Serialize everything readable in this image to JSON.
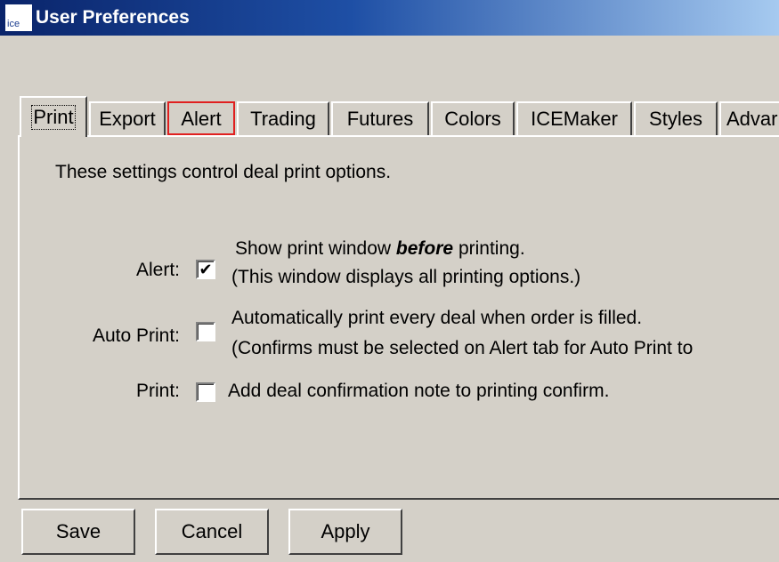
{
  "window": {
    "title": "User Preferences",
    "icon_text": "ice"
  },
  "tabs": [
    {
      "label": "Print",
      "active": true
    },
    {
      "label": "Export",
      "active": false
    },
    {
      "label": "Alert",
      "active": false,
      "highlighted": true
    },
    {
      "label": "Trading",
      "active": false
    },
    {
      "label": "Futures",
      "active": false
    },
    {
      "label": "Colors",
      "active": false
    },
    {
      "label": "ICEMaker",
      "active": false
    },
    {
      "label": "Styles",
      "active": false
    },
    {
      "label": "Advar",
      "active": false
    }
  ],
  "panel": {
    "description": "These settings control deal print options.",
    "options": [
      {
        "label": "Alert:",
        "checked": true,
        "line1_pre": "Show print window ",
        "line1_emph": "before",
        "line1_post": "  printing.",
        "line2": "(This window displays all printing options.)"
      },
      {
        "label": "Auto Print:",
        "checked": false,
        "line1": "Automatically print every deal when order is filled.",
        "line2": "(Confirms must be selected on Alert tab for Auto Print to"
      },
      {
        "label": "Print:",
        "checked": false,
        "line1": "Add deal confirmation note to printing confirm."
      }
    ]
  },
  "buttons": {
    "save": "Save",
    "cancel": "Cancel",
    "apply": "Apply"
  },
  "colors": {
    "dialog_bg": "#d4d0c8",
    "titlebar_start": "#0a246a",
    "titlebar_end": "#a6caf0",
    "highlight": "#e02020"
  },
  "icons": {
    "checkmark": "✔"
  }
}
